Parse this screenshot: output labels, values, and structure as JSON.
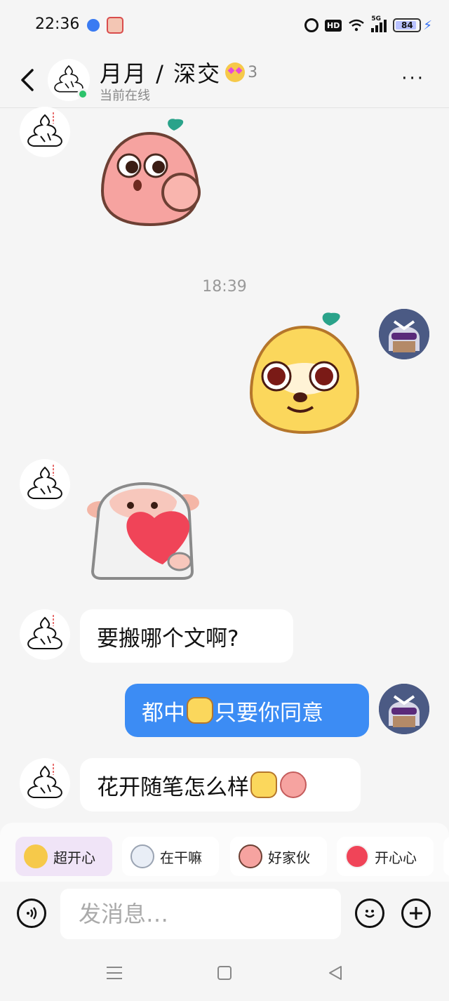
{
  "status_bar": {
    "time": "22:36",
    "hd_label": "HD",
    "network_label": "5G",
    "battery": "84"
  },
  "header": {
    "title": "月月 / 深交",
    "level": "3",
    "status": "当前在线",
    "more_label": "···"
  },
  "messages": {
    "timestamp": "18:39",
    "text_1": "要搬哪个文啊?",
    "text_2_before": "都中",
    "text_2_after": "只要你同意",
    "text_3": "花开随笔怎么样"
  },
  "quick_stickers": [
    {
      "label": "超开心",
      "icon": "starstruck-emoji-icon"
    },
    {
      "label": "在干嘛",
      "icon": "sticker-icon"
    },
    {
      "label": "好家伙",
      "icon": "sticker-icon"
    },
    {
      "label": "开心心",
      "icon": "sticker-icon"
    }
  ],
  "input": {
    "placeholder": "发消息…"
  },
  "colors": {
    "accent": "#3c8cf4",
    "online": "#2cc36b"
  }
}
